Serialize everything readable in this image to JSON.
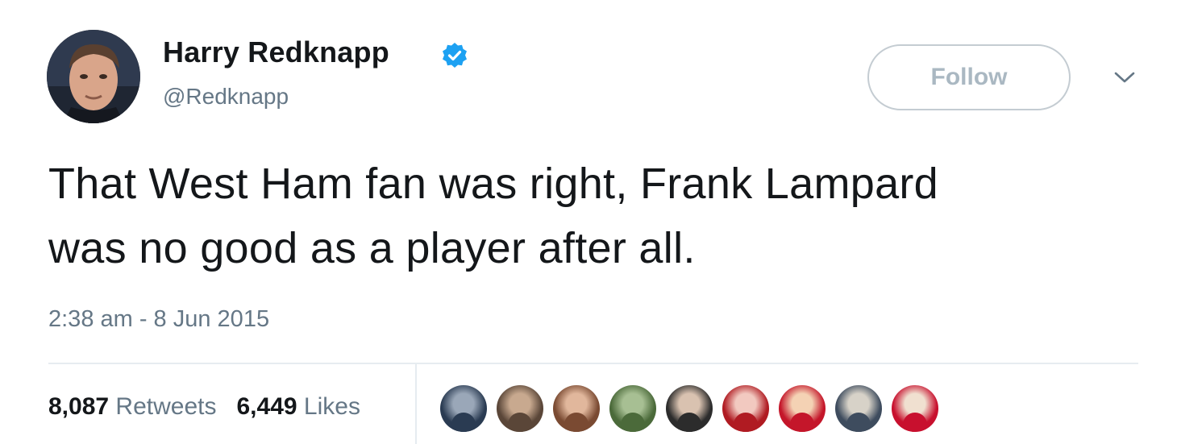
{
  "tweet": {
    "author_name": "Harry Redknapp",
    "author_handle": "@Redknapp",
    "text_line1": "That West Ham fan was right, Frank Lampard",
    "text_line2": "was no good as a player after all.",
    "timestamp": "2:38 am - 8 Jun 2015",
    "follow_label": "Follow",
    "retweets_count": "8,087",
    "retweets_label": "Retweets",
    "likes_count": "6,449",
    "likes_label": "Likes"
  },
  "icons": {
    "verified": "verified-badge-icon",
    "chevron": "chevron-down-icon",
    "avatar": "profile-photo"
  },
  "colors": {
    "verified_blue": "#1da1f2",
    "secondary_text": "#657786",
    "primary_text": "#14171a",
    "follow_text": "#aab8c2",
    "border": "#c4ccd2"
  },
  "likers": [
    {
      "name": "liker-avatar-1",
      "c1": "#2a3b52",
      "c2": "#9aa7b8"
    },
    {
      "name": "liker-avatar-2",
      "c1": "#5a4638",
      "c2": "#c8a98f"
    },
    {
      "name": "liker-avatar-3",
      "c1": "#7a4a32",
      "c2": "#e1b79c"
    },
    {
      "name": "liker-avatar-4",
      "c1": "#4b6a3a",
      "c2": "#a7bf93"
    },
    {
      "name": "liker-avatar-5",
      "c1": "#2c2c2c",
      "c2": "#d9c2b0"
    },
    {
      "name": "liker-avatar-6",
      "c1": "#b01b22",
      "c2": "#f2c9c0"
    },
    {
      "name": "liker-avatar-7",
      "c1": "#c4162a",
      "c2": "#f4d2b4"
    },
    {
      "name": "liker-avatar-8",
      "c1": "#3e4c5e",
      "c2": "#d7d2c8"
    },
    {
      "name": "liker-avatar-9",
      "c1": "#c8102e",
      "c2": "#f0e0d0"
    }
  ]
}
